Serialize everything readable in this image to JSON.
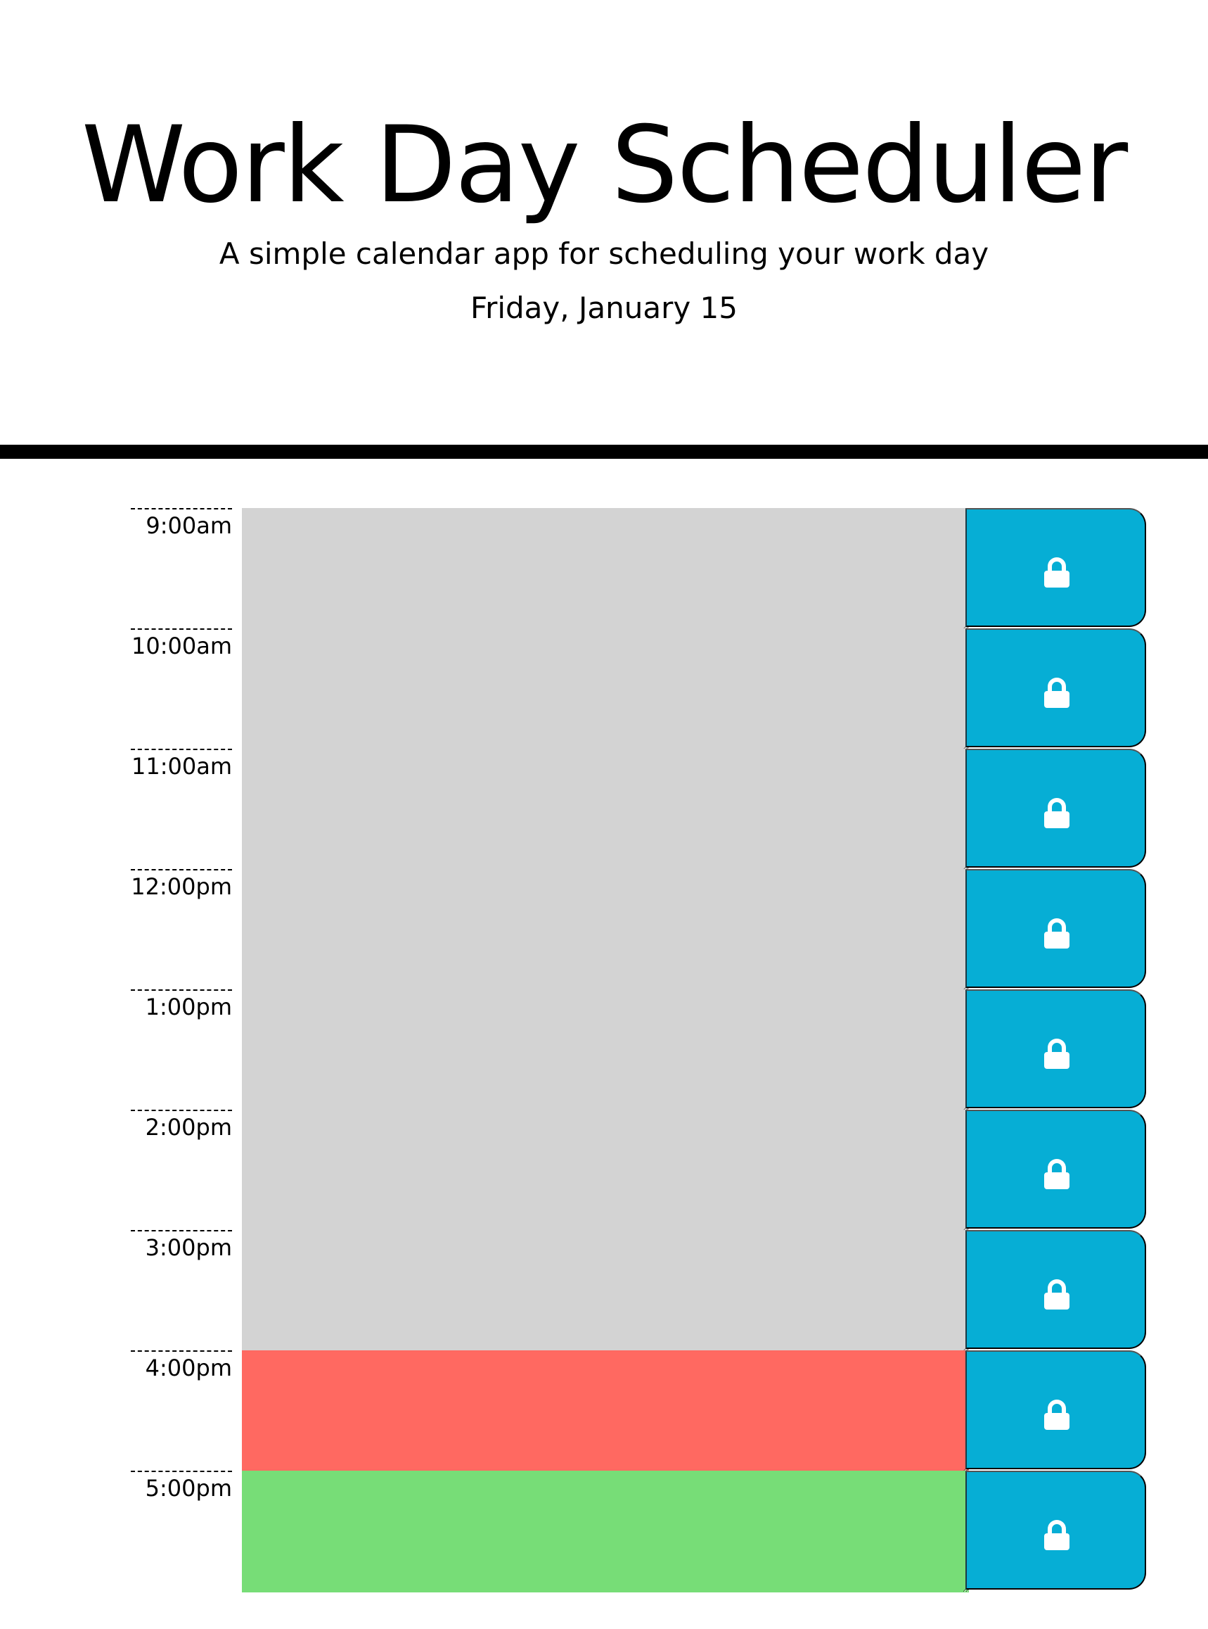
{
  "header": {
    "title": "Work Day Scheduler",
    "lead": "A simple calendar app for scheduling your work day",
    "current_day": "Friday, January 15"
  },
  "colors": {
    "past": "#d3d3d3",
    "present": "#ff6961",
    "future": "#77dd77",
    "save_button": "#06aed5"
  },
  "time_blocks": [
    {
      "hour": "9:00am",
      "state": "past",
      "text": "",
      "save_icon": "lock-icon"
    },
    {
      "hour": "10:00am",
      "state": "past",
      "text": "",
      "save_icon": "lock-icon"
    },
    {
      "hour": "11:00am",
      "state": "past",
      "text": "",
      "save_icon": "lock-icon"
    },
    {
      "hour": "12:00pm",
      "state": "past",
      "text": "",
      "save_icon": "lock-icon"
    },
    {
      "hour": "1:00pm",
      "state": "past",
      "text": "",
      "save_icon": "lock-icon"
    },
    {
      "hour": "2:00pm",
      "state": "past",
      "text": "",
      "save_icon": "lock-icon"
    },
    {
      "hour": "3:00pm",
      "state": "past",
      "text": "",
      "save_icon": "lock-icon"
    },
    {
      "hour": "4:00pm",
      "state": "present",
      "text": "",
      "save_icon": "lock-icon"
    },
    {
      "hour": "5:00pm",
      "state": "future",
      "text": "",
      "save_icon": "lock-icon"
    }
  ]
}
